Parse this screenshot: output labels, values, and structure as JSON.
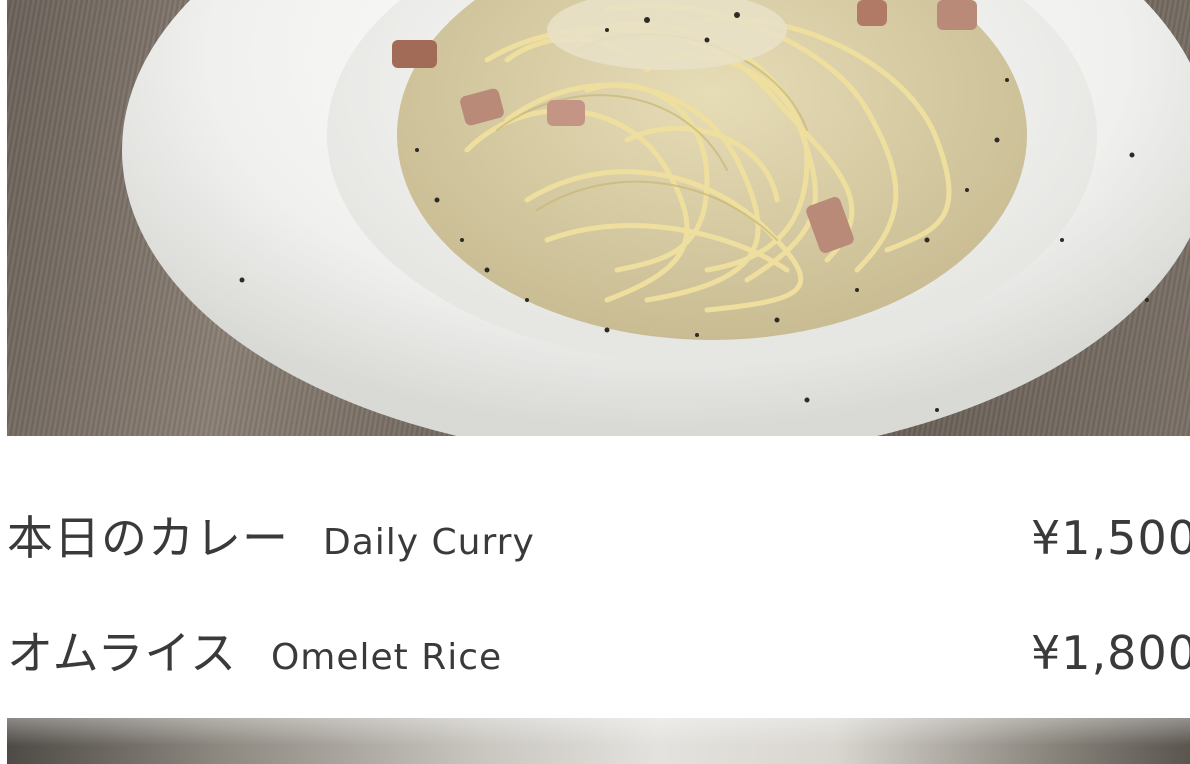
{
  "menu": {
    "items": [
      {
        "name_ja": "本日のカレー",
        "name_en": "Daily Curry",
        "price": "¥1,500"
      },
      {
        "name_ja": "オムライス",
        "name_en": "Omelet Rice",
        "price": "¥1,800"
      }
    ]
  },
  "images": {
    "top_photo": "carbonara-pasta-photo",
    "bottom_photo": "next-dish-photo"
  },
  "colors": {
    "text": "#3a3a3a",
    "background": "#ffffff",
    "table_wood": "#6b625a",
    "plate": "#f3f3f1",
    "sauce": "#d8cfae",
    "pasta": "#ecdc9e"
  }
}
